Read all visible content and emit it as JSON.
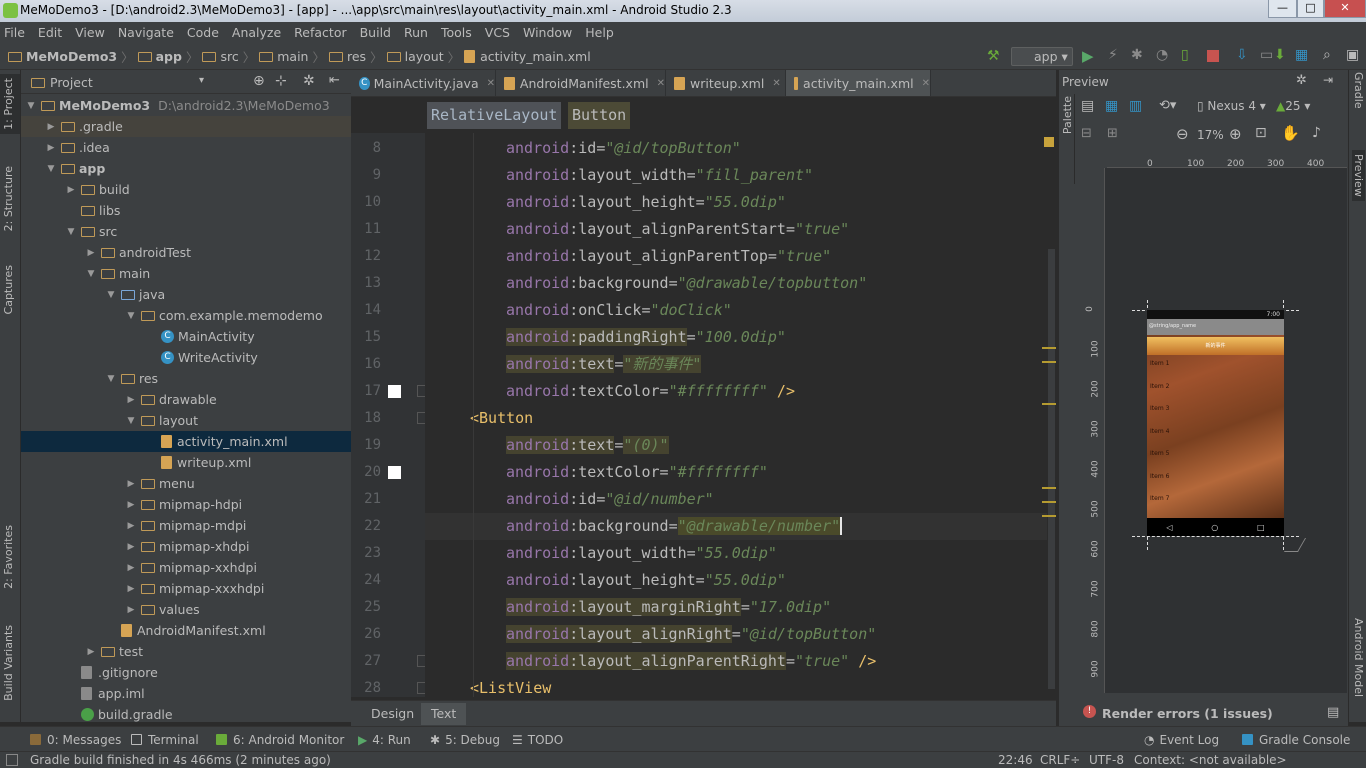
{
  "window": {
    "title": "MeMoDemo3 - [D:\\android2.3\\MeMoDemo3] - [app] - ...\\app\\src\\main\\res\\layout\\activity_main.xml - Android Studio 2.3",
    "minimize": "—",
    "maximize": "□",
    "close": "✕"
  },
  "menu": [
    "File",
    "Edit",
    "View",
    "Navigate",
    "Code",
    "Analyze",
    "Refactor",
    "Build",
    "Run",
    "Tools",
    "VCS",
    "Window",
    "Help"
  ],
  "breadcrumb": [
    "MeMoDemo3",
    "app",
    "src",
    "main",
    "res",
    "layout",
    "activity_main.xml"
  ],
  "toolbar": {
    "run_config": "app"
  },
  "project_panel": {
    "header": "Project",
    "tree": [
      {
        "label": "MeMoDemo3",
        "suffix": "D:\\android2.3\\MeMoDemo3",
        "level": 0,
        "arrow": "▼",
        "icon": "folder"
      },
      {
        "label": ".gradle",
        "level": 1,
        "arrow": "▶",
        "icon": "folder"
      },
      {
        "label": ".idea",
        "level": 1,
        "arrow": "▶",
        "icon": "folder"
      },
      {
        "label": "app",
        "level": 1,
        "arrow": "▼",
        "icon": "folder"
      },
      {
        "label": "build",
        "level": 2,
        "arrow": "▶",
        "icon": "folder"
      },
      {
        "label": "libs",
        "level": 2,
        "arrow": "",
        "icon": "folder"
      },
      {
        "label": "src",
        "level": 2,
        "arrow": "▼",
        "icon": "folder"
      },
      {
        "label": "androidTest",
        "level": 3,
        "arrow": "▶",
        "icon": "folder"
      },
      {
        "label": "main",
        "level": 3,
        "arrow": "▼",
        "icon": "folder"
      },
      {
        "label": "java",
        "level": 4,
        "arrow": "▼",
        "icon": "folder-blue"
      },
      {
        "label": "com.example.memodemo",
        "level": 5,
        "arrow": "▼",
        "icon": "folder"
      },
      {
        "label": "MainActivity",
        "level": 6,
        "arrow": "",
        "icon": "class"
      },
      {
        "label": "WriteActivity",
        "level": 6,
        "arrow": "",
        "icon": "class"
      },
      {
        "label": "res",
        "level": 4,
        "arrow": "▼",
        "icon": "folder"
      },
      {
        "label": "drawable",
        "level": 5,
        "arrow": "▶",
        "icon": "folder"
      },
      {
        "label": "layout",
        "level": 5,
        "arrow": "▼",
        "icon": "folder"
      },
      {
        "label": "activity_main.xml",
        "level": 6,
        "arrow": "",
        "icon": "xml"
      },
      {
        "label": "writeup.xml",
        "level": 6,
        "arrow": "",
        "icon": "xml"
      },
      {
        "label": "menu",
        "level": 5,
        "arrow": "▶",
        "icon": "folder"
      },
      {
        "label": "mipmap-hdpi",
        "level": 5,
        "arrow": "▶",
        "icon": "folder"
      },
      {
        "label": "mipmap-mdpi",
        "level": 5,
        "arrow": "▶",
        "icon": "folder"
      },
      {
        "label": "mipmap-xhdpi",
        "level": 5,
        "arrow": "▶",
        "icon": "folder"
      },
      {
        "label": "mipmap-xxhdpi",
        "level": 5,
        "arrow": "▶",
        "icon": "folder"
      },
      {
        "label": "mipmap-xxxhdpi",
        "level": 5,
        "arrow": "▶",
        "icon": "folder"
      },
      {
        "label": "values",
        "level": 5,
        "arrow": "▶",
        "icon": "folder"
      },
      {
        "label": "AndroidManifest.xml",
        "level": 4,
        "arrow": "",
        "icon": "xml"
      },
      {
        "label": "test",
        "level": 3,
        "arrow": "▶",
        "icon": "folder"
      },
      {
        "label": ".gitignore",
        "level": 2,
        "arrow": "",
        "icon": "file"
      },
      {
        "label": "app.iml",
        "level": 2,
        "arrow": "",
        "icon": "file"
      },
      {
        "label": "build.gradle",
        "level": 2,
        "arrow": "",
        "icon": "gradle"
      }
    ]
  },
  "editor": {
    "tabs": [
      {
        "label": "MainActivity.java",
        "icon": "class"
      },
      {
        "label": "AndroidManifest.xml",
        "icon": "xml"
      },
      {
        "label": "writeup.xml",
        "icon": "xml"
      },
      {
        "label": "activity_main.xml",
        "icon": "xml"
      }
    ],
    "breadcrumb": [
      "RelativeLayout",
      "Button"
    ],
    "bottom_tabs": [
      "Design",
      "Text"
    ]
  },
  "preview": {
    "title": "Preview",
    "palette": "Palette",
    "device": "Nexus 4",
    "api": "25",
    "zoom": "17%",
    "ruler_top": [
      "0",
      "100",
      "200",
      "300",
      "400"
    ],
    "ruler_left": [
      "0",
      "100",
      "200",
      "300",
      "400",
      "500",
      "600",
      "700",
      "800",
      "900"
    ],
    "status_time": "7:00",
    "app_bar": "@string/app_name",
    "top_button": "新的事件",
    "list_items": [
      "Item 1",
      "Item 2",
      "Item 3",
      "Item 4",
      "Item 5",
      "Item 6",
      "Item 7"
    ],
    "render_errors": "Render errors (1 issues)"
  },
  "right_tabs": [
    "Gradle",
    "Preview",
    "Android Model"
  ],
  "left_tabs": [
    "1: Project",
    "2: Structure",
    "Captures",
    "2: Favorites",
    "Build Variants"
  ],
  "tool_windows": [
    "0: Messages",
    "Terminal",
    "6: Android Monitor",
    "4: Run",
    "5: Debug",
    "TODO",
    "Event Log",
    "Gradle Console"
  ],
  "status": {
    "message": "Gradle build finished in 4s 466ms (2 minutes ago)",
    "position": "22:46",
    "line_sep": "CRLF÷",
    "encoding": "UTF-8",
    "context": "Context: <not available>"
  }
}
